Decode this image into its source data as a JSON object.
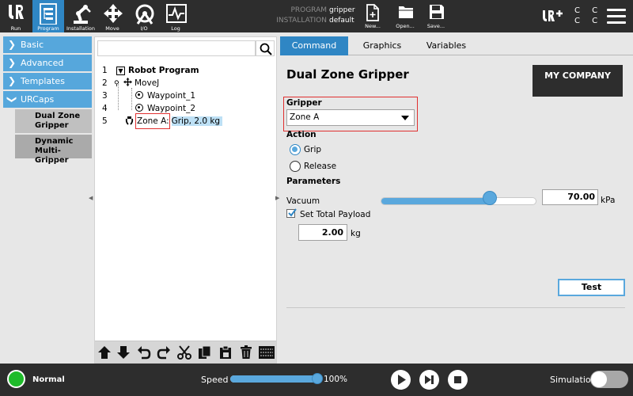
{
  "topbar": {
    "nav": [
      {
        "label": "Run",
        "icon": "ur-logo-icon"
      },
      {
        "label": "Program",
        "icon": "program-icon",
        "active": true
      },
      {
        "label": "Installation",
        "icon": "robot-arm-icon"
      },
      {
        "label": "Move",
        "icon": "move-arrows-icon"
      },
      {
        "label": "I/O",
        "icon": "io-icon"
      },
      {
        "label": "Log",
        "icon": "log-icon"
      }
    ],
    "program_key": "PROGRAM",
    "program_value": "gripper",
    "installation_key": "INSTALLATION",
    "installation_value": "default",
    "file": [
      {
        "label": "New...",
        "icon": "new-file-icon"
      },
      {
        "label": "Open...",
        "icon": "folder-icon"
      },
      {
        "label": "Save...",
        "icon": "save-icon"
      }
    ],
    "cc": "C C\nC C"
  },
  "leftnav": {
    "items": [
      "Basic",
      "Advanced",
      "Templates",
      "URCaps"
    ],
    "urcaps_children": [
      "Dual Zone Gripper",
      "Dynamic Multi-Gripper"
    ]
  },
  "tree": {
    "rows": [
      {
        "num": "1",
        "text": "Robot Program"
      },
      {
        "num": "2",
        "text": "MoveJ"
      },
      {
        "num": "3",
        "text": "Waypoint_1"
      },
      {
        "num": "4",
        "text": "Waypoint_2"
      },
      {
        "num": "5",
        "zone": "Zone A:",
        "text": "Grip, 2.0 kg"
      }
    ]
  },
  "tabs": [
    "Command",
    "Graphics",
    "Variables"
  ],
  "command": {
    "title": "Dual Zone Gripper",
    "company": "MY COMPANY",
    "gripper_label": "Gripper",
    "gripper_value": "Zone A",
    "action_label": "Action",
    "action_options": [
      "Grip",
      "Release"
    ],
    "action_selected": "Grip",
    "parameters_label": "Parameters",
    "vacuum_label": "Vacuum",
    "vacuum_value": "70.00",
    "vacuum_unit": "kPa",
    "vacuum_slider_fraction": 0.7,
    "payload_label": "Set Total Payload",
    "payload_checked": true,
    "payload_value": "2.00",
    "payload_unit": "kg",
    "test_label": "Test"
  },
  "bottombar": {
    "status": "Normal",
    "status_color": "#1fbb2b",
    "speed_label": "Speed",
    "speed_value": "100%",
    "speed_fraction": 1.0,
    "simulation_label": "Simulation",
    "simulation_on": false
  },
  "colors": {
    "accent": "#2f86c4",
    "nav_blue": "#56a7dc",
    "highlight": "#e03030"
  }
}
